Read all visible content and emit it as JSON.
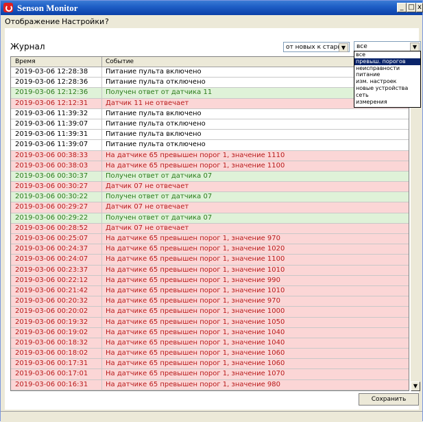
{
  "window": {
    "title": "Senson Monitor",
    "minimize": "_",
    "maximize": "□",
    "close": "x"
  },
  "menu": {
    "items": [
      "Отображение",
      "Настройки",
      "?"
    ]
  },
  "journal": {
    "label": "Журнал"
  },
  "sort_select": {
    "value": "от новых к старым",
    "arrow": "▼"
  },
  "filter_select": {
    "value": "все",
    "arrow": "▼",
    "options": [
      "все",
      "превыш. порогов",
      "неисправности",
      "питание",
      "изм. настроек",
      "новые устройства",
      "сеть",
      "измерения"
    ],
    "highlighted_index": 1
  },
  "table": {
    "columns": [
      "Время",
      "Событие"
    ],
    "rows": [
      {
        "time": "2019-03-06 12:28:38",
        "event": "Питание пульта включено",
        "status": "normal"
      },
      {
        "time": "2019-03-06 12:28:36",
        "event": "Питание пульта отключено",
        "status": "normal"
      },
      {
        "time": "2019-03-06 12:12:36",
        "event": "Получен ответ от датчика 11",
        "status": "ok"
      },
      {
        "time": "2019-03-06 12:12:31",
        "event": "Датчик 11 не отвечает",
        "status": "warn"
      },
      {
        "time": "2019-03-06 11:39:32",
        "event": "Питание пульта включено",
        "status": "normal"
      },
      {
        "time": "2019-03-06 11:39:07",
        "event": "Питание пульта отключено",
        "status": "normal"
      },
      {
        "time": "2019-03-06 11:39:31",
        "event": "Питание пульта включено",
        "status": "normal"
      },
      {
        "time": "2019-03-06 11:39:07",
        "event": "Питание пульта отключено",
        "status": "normal"
      },
      {
        "time": "2019-03-06 00:38:33",
        "event": "На датчике 65 превышен порог 1, значение 1110",
        "status": "warn"
      },
      {
        "time": "2019-03-06 00:38:03",
        "event": "На датчике 65 превышен порог 1, значение 1100",
        "status": "warn"
      },
      {
        "time": "2019-03-06 00:30:37",
        "event": "Получен ответ от датчика 07",
        "status": "ok"
      },
      {
        "time": "2019-03-06 00:30:27",
        "event": "Датчик 07 не отвечает",
        "status": "warn"
      },
      {
        "time": "2019-03-06 00:30:22",
        "event": "Получен ответ от датчика 07",
        "status": "ok"
      },
      {
        "time": "2019-03-06 00:29:27",
        "event": "Датчик 07 не отвечает",
        "status": "warn"
      },
      {
        "time": "2019-03-06 00:29:22",
        "event": "Получен ответ от датчика 07",
        "status": "ok"
      },
      {
        "time": "2019-03-06 00:28:52",
        "event": "Датчик 07 не отвечает",
        "status": "warn"
      },
      {
        "time": "2019-03-06 00:25:07",
        "event": "На датчике 65 превышен порог 1, значение 970",
        "status": "warn"
      },
      {
        "time": "2019-03-06 00:24:37",
        "event": "На датчике 65 превышен порог 1, значение 1020",
        "status": "warn"
      },
      {
        "time": "2019-03-06 00:24:07",
        "event": "На датчике 65 превышен порог 1, значение 1100",
        "status": "warn"
      },
      {
        "time": "2019-03-06 00:23:37",
        "event": "На датчике 65 превышен порог 1, значение 1010",
        "status": "warn"
      },
      {
        "time": "2019-03-06 00:22:12",
        "event": "На датчике 65 превышен порог 1, значение 990",
        "status": "warn"
      },
      {
        "time": "2019-03-06 00:21:42",
        "event": "На датчике 65 превышен порог 1, значение 1010",
        "status": "warn"
      },
      {
        "time": "2019-03-06 00:20:32",
        "event": "На датчике 65 превышен порог 1, значение 970",
        "status": "warn"
      },
      {
        "time": "2019-03-06 00:20:02",
        "event": "На датчике 65 превышен порог 1, значение 1000",
        "status": "warn"
      },
      {
        "time": "2019-03-06 00:19:32",
        "event": "На датчике 65 превышен порог 1, значение 1050",
        "status": "warn"
      },
      {
        "time": "2019-03-06 00:19:02",
        "event": "На датчике 65 превышен порог 1, значение 1040",
        "status": "warn"
      },
      {
        "time": "2019-03-06 00:18:32",
        "event": "На датчике 65 превышен порог 1, значение 1040",
        "status": "warn"
      },
      {
        "time": "2019-03-06 00:18:02",
        "event": "На датчике 65 превышен порог 1, значение 1060",
        "status": "warn"
      },
      {
        "time": "2019-03-06 00:17:31",
        "event": "На датчике 65 превышен порог 1, значение 1060",
        "status": "warn"
      },
      {
        "time": "2019-03-06 00:17:01",
        "event": "На датчике 65 превышен порог 1, значение 1070",
        "status": "warn"
      },
      {
        "time": "2019-03-06 00:16:31",
        "event": "На датчике 65 превышен порог 1, значение 980",
        "status": "warn"
      }
    ]
  },
  "buttons": {
    "save_label": "Сохранить"
  },
  "scrollbar": {
    "down_arrow": "▼"
  },
  "colors": {
    "title_bar": "#1f5fc6",
    "warn_bg": "#fbd6d6",
    "warn_text": "#b81a1a",
    "ok_bg": "#dff2d8",
    "ok_text": "#2a7a1a",
    "selected_option": "#0a246a"
  },
  "icons": {
    "app": "app-logo-icon"
  }
}
